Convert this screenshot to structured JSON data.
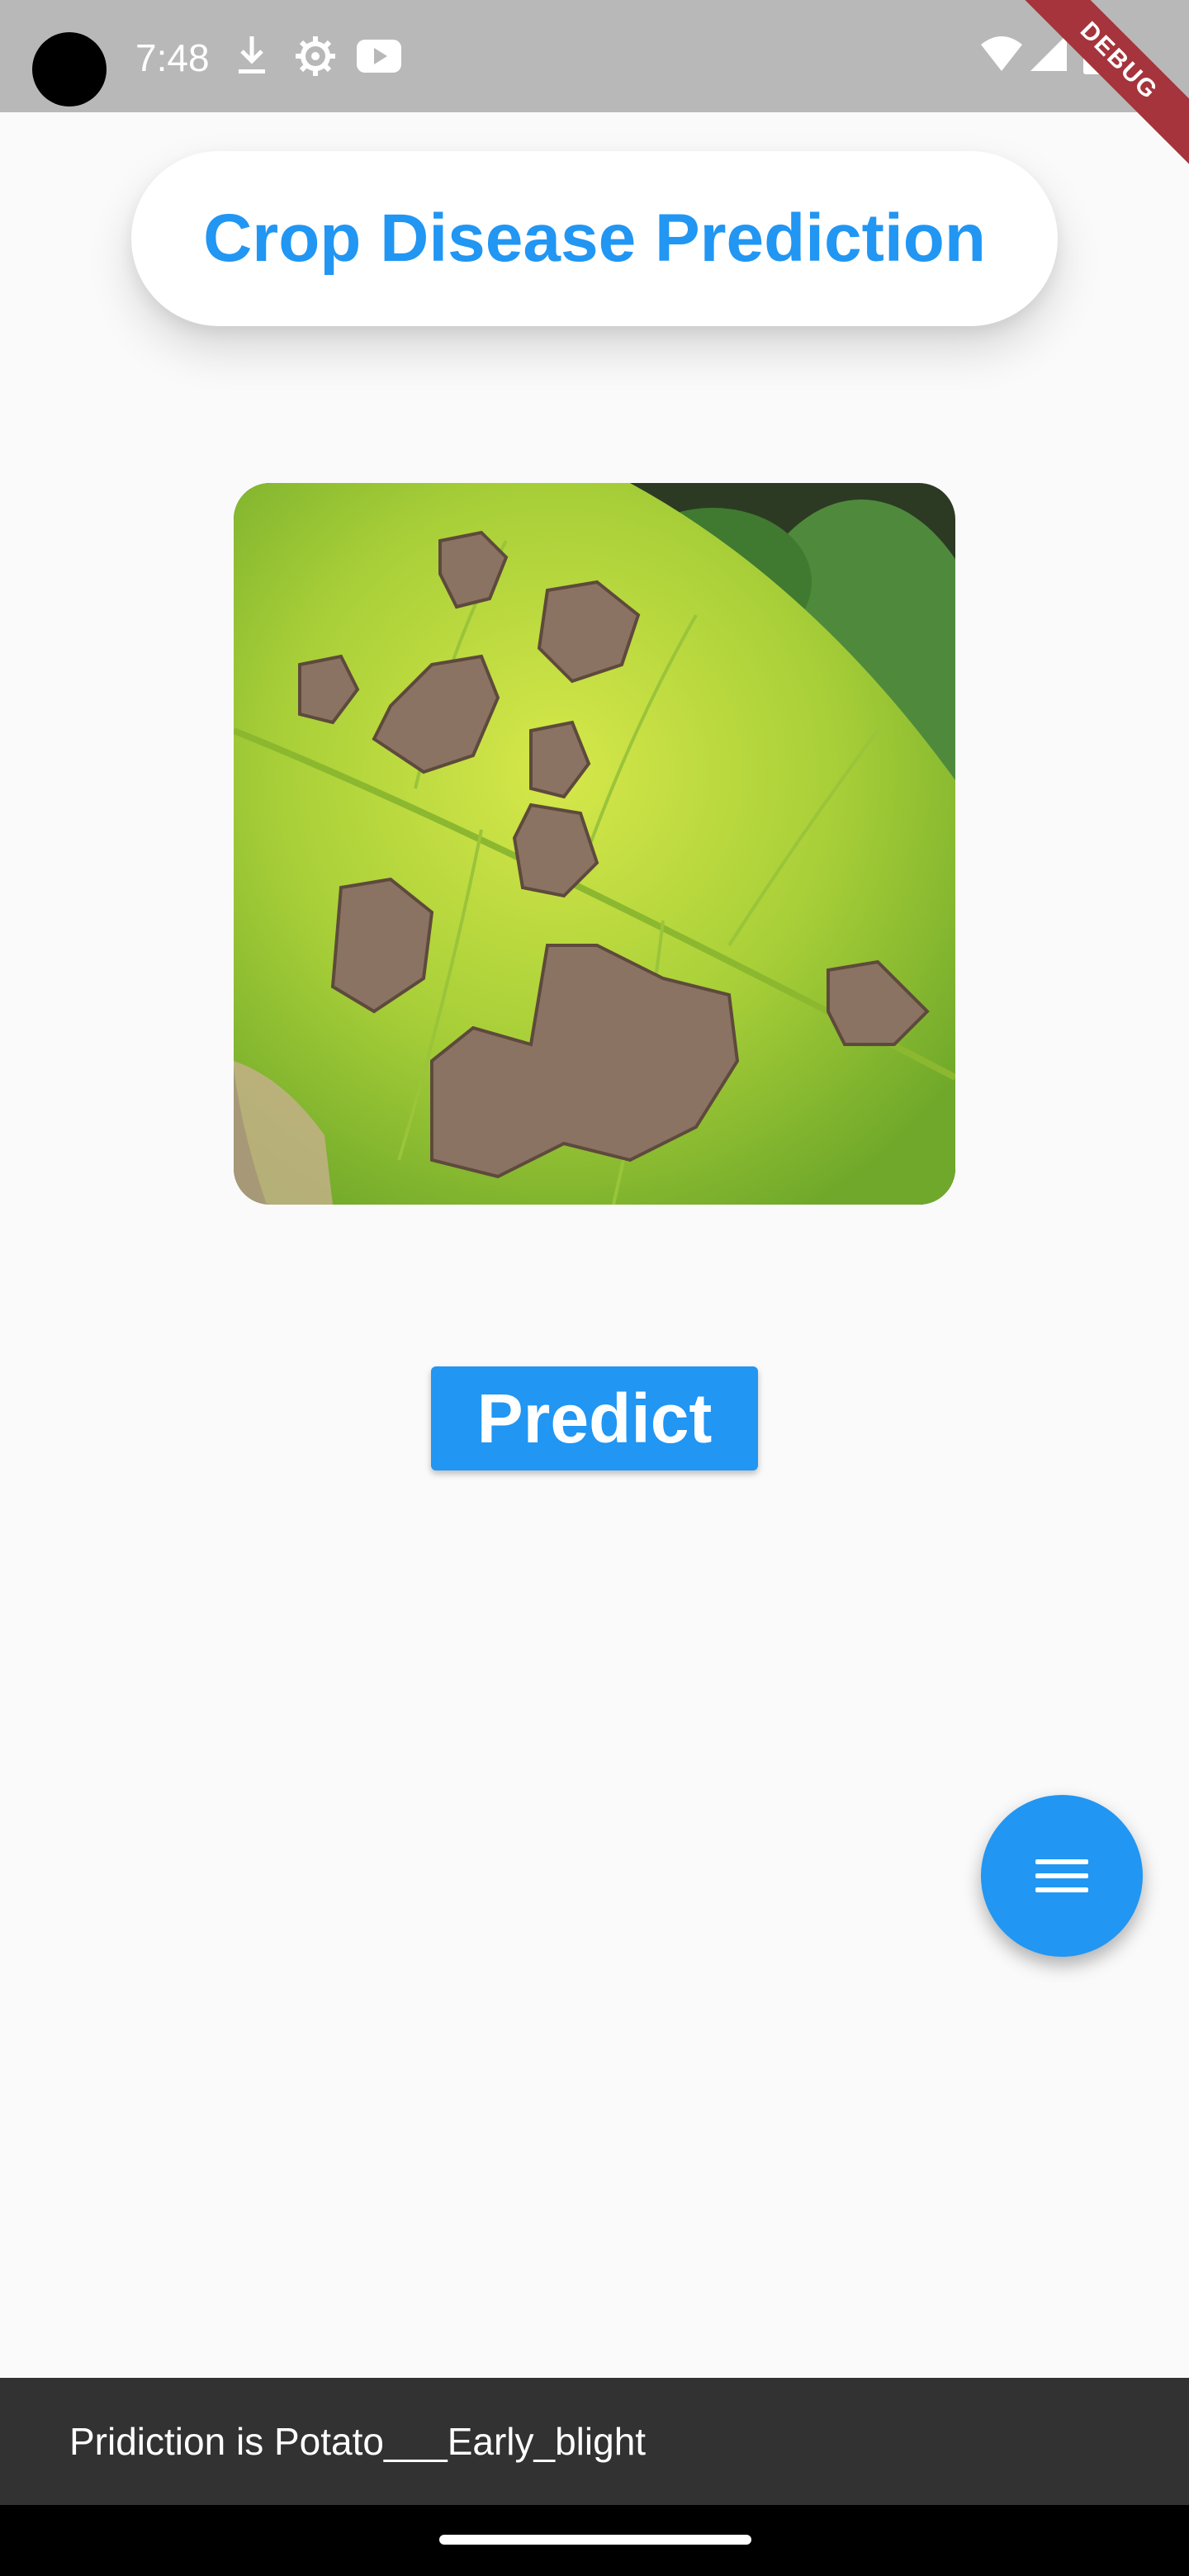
{
  "status_bar": {
    "time": "7:48",
    "icons": [
      "download-icon",
      "settings-icon",
      "youtube-icon",
      "wifi-icon",
      "signal-icon",
      "battery-icon"
    ],
    "debug_banner": "DEBUG"
  },
  "header": {
    "title": "Crop Disease Prediction"
  },
  "main": {
    "image": "leaf-image",
    "predict_label": "Predict"
  },
  "fab": {
    "icon": "menu-icon"
  },
  "snackbar": {
    "message": "Pridiction is Potato___Early_blight"
  },
  "colors": {
    "accent": "#2196f3",
    "background": "#fafafa",
    "snackbar": "#323232",
    "status_bar": "#b8b8b8"
  }
}
